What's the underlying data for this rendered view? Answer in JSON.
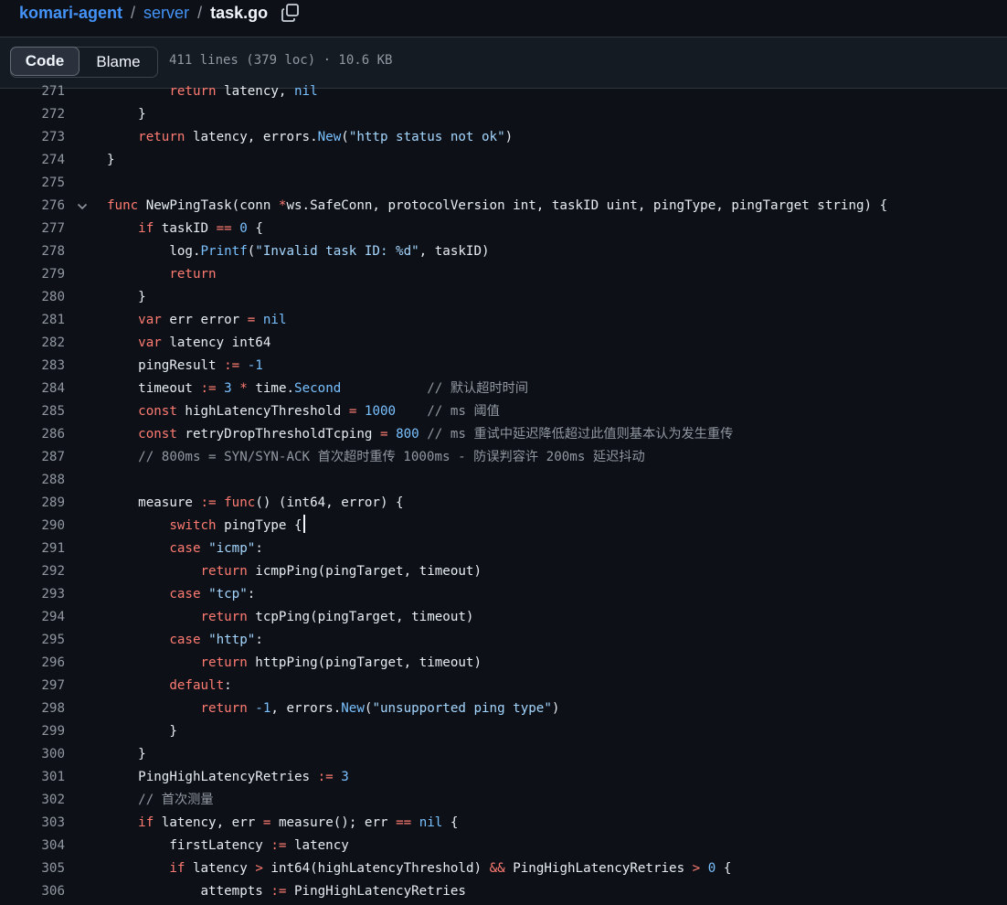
{
  "breadcrumb": {
    "repo": "komari-agent",
    "separator": "/",
    "dir": "server",
    "file": "task.go",
    "copy_icon": "copy-icon"
  },
  "toolbar": {
    "code_tab": "Code",
    "blame_tab": "Blame",
    "file_info": "411 lines (379 loc) · 10.6 KB"
  },
  "colors": {
    "background": "#0d1117",
    "keyword": "#ff7b72",
    "constant": "#79c0ff",
    "string": "#a5d6ff",
    "comment": "#9198a1",
    "link": "#4493f8"
  },
  "code": {
    "lines": [
      {
        "n": "271",
        "tokens": [
          {
            "t": "        "
          },
          {
            "t": "return",
            "c": "k"
          },
          {
            "t": " latency, "
          },
          {
            "t": "nil",
            "c": "f"
          }
        ]
      },
      {
        "n": "272",
        "tokens": [
          {
            "t": "    }"
          }
        ]
      },
      {
        "n": "273",
        "tokens": [
          {
            "t": "    "
          },
          {
            "t": "return",
            "c": "k"
          },
          {
            "t": " latency, errors."
          },
          {
            "t": "New",
            "c": "f"
          },
          {
            "t": "("
          },
          {
            "t": "\"http status not ok\"",
            "c": "s"
          },
          {
            "t": ")"
          }
        ]
      },
      {
        "n": "274",
        "tokens": [
          {
            "t": "}"
          }
        ]
      },
      {
        "n": "275",
        "tokens": []
      },
      {
        "n": "276",
        "fold": true,
        "tokens": [
          {
            "t": "func",
            "c": "k"
          },
          {
            "t": " NewPingTask(conn "
          },
          {
            "t": "*",
            "c": "k"
          },
          {
            "t": "ws.SafeConn, protocolVersion int, taskID uint, pingType, pingTarget string) {"
          }
        ]
      },
      {
        "n": "277",
        "tokens": [
          {
            "t": "    "
          },
          {
            "t": "if",
            "c": "k"
          },
          {
            "t": " taskID "
          },
          {
            "t": "==",
            "c": "k"
          },
          {
            "t": " "
          },
          {
            "t": "0",
            "c": "f"
          },
          {
            "t": " {"
          }
        ]
      },
      {
        "n": "278",
        "tokens": [
          {
            "t": "        log."
          },
          {
            "t": "Printf",
            "c": "f"
          },
          {
            "t": "("
          },
          {
            "t": "\"Invalid task ID: %d\"",
            "c": "s"
          },
          {
            "t": ", taskID)"
          }
        ]
      },
      {
        "n": "279",
        "tokens": [
          {
            "t": "        "
          },
          {
            "t": "return",
            "c": "k"
          }
        ]
      },
      {
        "n": "280",
        "tokens": [
          {
            "t": "    }"
          }
        ]
      },
      {
        "n": "281",
        "tokens": [
          {
            "t": "    "
          },
          {
            "t": "var",
            "c": "k"
          },
          {
            "t": " err error "
          },
          {
            "t": "=",
            "c": "k"
          },
          {
            "t": " "
          },
          {
            "t": "nil",
            "c": "f"
          }
        ]
      },
      {
        "n": "282",
        "tokens": [
          {
            "t": "    "
          },
          {
            "t": "var",
            "c": "k"
          },
          {
            "t": " latency int64"
          }
        ]
      },
      {
        "n": "283",
        "tokens": [
          {
            "t": "    pingResult "
          },
          {
            "t": ":=",
            "c": "k"
          },
          {
            "t": " "
          },
          {
            "t": "-1",
            "c": "f"
          }
        ]
      },
      {
        "n": "284",
        "tokens": [
          {
            "t": "    timeout "
          },
          {
            "t": ":=",
            "c": "k"
          },
          {
            "t": " "
          },
          {
            "t": "3",
            "c": "f"
          },
          {
            "t": " "
          },
          {
            "t": "*",
            "c": "k"
          },
          {
            "t": " time."
          },
          {
            "t": "Second",
            "c": "f"
          },
          {
            "t": "           "
          },
          {
            "t": "// 默认超时时间",
            "c": "c"
          }
        ]
      },
      {
        "n": "285",
        "tokens": [
          {
            "t": "    "
          },
          {
            "t": "const",
            "c": "k"
          },
          {
            "t": " highLatencyThreshold "
          },
          {
            "t": "=",
            "c": "k"
          },
          {
            "t": " "
          },
          {
            "t": "1000",
            "c": "f"
          },
          {
            "t": "    "
          },
          {
            "t": "// ms 阈值",
            "c": "c"
          }
        ]
      },
      {
        "n": "286",
        "tokens": [
          {
            "t": "    "
          },
          {
            "t": "const",
            "c": "k"
          },
          {
            "t": " retryDropThresholdTcping "
          },
          {
            "t": "=",
            "c": "k"
          },
          {
            "t": " "
          },
          {
            "t": "800",
            "c": "f"
          },
          {
            "t": " "
          },
          {
            "t": "// ms 重试中延迟降低超过此值则基本认为发生重传",
            "c": "c"
          }
        ]
      },
      {
        "n": "287",
        "tokens": [
          {
            "t": "    "
          },
          {
            "t": "// 800ms = SYN/SYN-ACK 首次超时重传 1000ms - 防误判容许 200ms 延迟抖动",
            "c": "c"
          }
        ]
      },
      {
        "n": "288",
        "tokens": []
      },
      {
        "n": "289",
        "tokens": [
          {
            "t": "    measure "
          },
          {
            "t": ":=",
            "c": "k"
          },
          {
            "t": " "
          },
          {
            "t": "func",
            "c": "k"
          },
          {
            "t": "() (int64, error) {"
          }
        ]
      },
      {
        "n": "290",
        "caret": true,
        "tokens": [
          {
            "t": "        "
          },
          {
            "t": "switch",
            "c": "k"
          },
          {
            "t": " pingType {"
          }
        ]
      },
      {
        "n": "291",
        "tokens": [
          {
            "t": "        "
          },
          {
            "t": "case",
            "c": "k"
          },
          {
            "t": " "
          },
          {
            "t": "\"icmp\"",
            "c": "s"
          },
          {
            "t": ":"
          }
        ]
      },
      {
        "n": "292",
        "tokens": [
          {
            "t": "            "
          },
          {
            "t": "return",
            "c": "k"
          },
          {
            "t": " icmpPing(pingTarget, timeout)"
          }
        ]
      },
      {
        "n": "293",
        "tokens": [
          {
            "t": "        "
          },
          {
            "t": "case",
            "c": "k"
          },
          {
            "t": " "
          },
          {
            "t": "\"tcp\"",
            "c": "s"
          },
          {
            "t": ":"
          }
        ]
      },
      {
        "n": "294",
        "tokens": [
          {
            "t": "            "
          },
          {
            "t": "return",
            "c": "k"
          },
          {
            "t": " tcpPing(pingTarget, timeout)"
          }
        ]
      },
      {
        "n": "295",
        "tokens": [
          {
            "t": "        "
          },
          {
            "t": "case",
            "c": "k"
          },
          {
            "t": " "
          },
          {
            "t": "\"http\"",
            "c": "s"
          },
          {
            "t": ":"
          }
        ]
      },
      {
        "n": "296",
        "tokens": [
          {
            "t": "            "
          },
          {
            "t": "return",
            "c": "k"
          },
          {
            "t": " httpPing(pingTarget, timeout)"
          }
        ]
      },
      {
        "n": "297",
        "tokens": [
          {
            "t": "        "
          },
          {
            "t": "default",
            "c": "k"
          },
          {
            "t": ":"
          }
        ]
      },
      {
        "n": "298",
        "tokens": [
          {
            "t": "            "
          },
          {
            "t": "return",
            "c": "k"
          },
          {
            "t": " "
          },
          {
            "t": "-1",
            "c": "f"
          },
          {
            "t": ", errors."
          },
          {
            "t": "New",
            "c": "f"
          },
          {
            "t": "("
          },
          {
            "t": "\"unsupported ping type\"",
            "c": "s"
          },
          {
            "t": ")"
          }
        ]
      },
      {
        "n": "299",
        "tokens": [
          {
            "t": "        }"
          }
        ]
      },
      {
        "n": "300",
        "tokens": [
          {
            "t": "    }"
          }
        ]
      },
      {
        "n": "301",
        "tokens": [
          {
            "t": "    PingHighLatencyRetries "
          },
          {
            "t": ":=",
            "c": "k"
          },
          {
            "t": " "
          },
          {
            "t": "3",
            "c": "f"
          }
        ]
      },
      {
        "n": "302",
        "tokens": [
          {
            "t": "    "
          },
          {
            "t": "// 首次测量",
            "c": "c"
          }
        ]
      },
      {
        "n": "303",
        "tokens": [
          {
            "t": "    "
          },
          {
            "t": "if",
            "c": "k"
          },
          {
            "t": " latency, err "
          },
          {
            "t": "=",
            "c": "k"
          },
          {
            "t": " measure(); err "
          },
          {
            "t": "==",
            "c": "k"
          },
          {
            "t": " "
          },
          {
            "t": "nil",
            "c": "f"
          },
          {
            "t": " {"
          }
        ]
      },
      {
        "n": "304",
        "tokens": [
          {
            "t": "        firstLatency "
          },
          {
            "t": ":=",
            "c": "k"
          },
          {
            "t": " latency"
          }
        ]
      },
      {
        "n": "305",
        "tokens": [
          {
            "t": "        "
          },
          {
            "t": "if",
            "c": "k"
          },
          {
            "t": " latency "
          },
          {
            "t": ">",
            "c": "k"
          },
          {
            "t": " int64(highLatencyThreshold) "
          },
          {
            "t": "&&",
            "c": "k"
          },
          {
            "t": " PingHighLatencyRetries "
          },
          {
            "t": ">",
            "c": "k"
          },
          {
            "t": " "
          },
          {
            "t": "0",
            "c": "f"
          },
          {
            "t": " {"
          }
        ]
      },
      {
        "n": "306",
        "tokens": [
          {
            "t": "            attempts "
          },
          {
            "t": ":=",
            "c": "k"
          },
          {
            "t": " PingHighLatencyRetries"
          }
        ]
      }
    ]
  }
}
